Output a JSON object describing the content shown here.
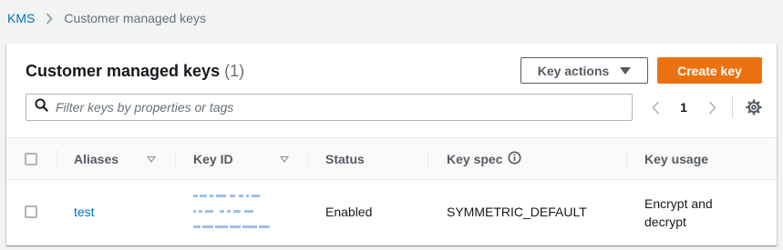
{
  "breadcrumb": {
    "root": "KMS",
    "current": "Customer managed keys"
  },
  "panel": {
    "title": "Customer managed keys",
    "count": "(1)",
    "key_actions_label": "Key actions",
    "create_key_label": "Create key"
  },
  "filter": {
    "placeholder": "Filter keys by properties or tags"
  },
  "pagination": {
    "current_page": "1"
  },
  "table": {
    "columns": {
      "aliases": "Aliases",
      "key_id": "Key ID",
      "status": "Status",
      "key_spec": "Key spec",
      "key_usage": "Key usage"
    },
    "rows": [
      {
        "alias": "test",
        "status": "Enabled",
        "key_spec": "SYMMETRIC_DEFAULT",
        "key_usage_line1": "Encrypt and",
        "key_usage_line2": "decrypt"
      }
    ]
  },
  "colors": {
    "link": "#0073bb",
    "primary": "#ec7211",
    "border": "#aab7b8",
    "muted": "#687078"
  },
  "icons": {
    "breadcrumb_separator": "chevron-right-icon",
    "filter": "search-icon",
    "pager_prev": "chevron-left-icon",
    "pager_next": "chevron-right-icon",
    "preferences": "gear-icon",
    "key_spec_info": "info-icon",
    "dropdown": "caret-down-icon",
    "sort": "sort-icon"
  }
}
